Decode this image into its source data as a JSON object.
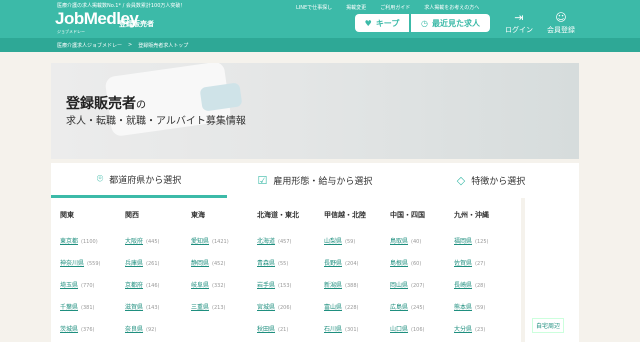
{
  "header": {
    "tagline": "医療介護の求人掲載数No.1* / 会員数累計100万人突破！",
    "logo": "JobMedley",
    "logo_sub": "ジョブメドレー",
    "job_type": "登録販売者",
    "links": [
      "LINEで仕事探し",
      "掲載変更",
      "ご利用ガイド",
      "求人掲載をお考えの方へ"
    ],
    "keep_label": "キープ",
    "recent_label": "最近見た求人",
    "login_label": "ログイン",
    "register_label": "会員登録"
  },
  "breadcrumb": [
    "医療介護求人ジョブメドレー",
    ">",
    "登録販売者求人トップ"
  ],
  "hero": {
    "title": "登録販売者",
    "title_suffix": "の",
    "subtitle": "求人・転職・就職・アルバイト募集情報"
  },
  "tabs": [
    {
      "label": "都道府県から選択",
      "icon": "map-pin-icon"
    },
    {
      "label": "雇用形態・給与から選択",
      "icon": "checkbox-icon"
    },
    {
      "label": "特徴から選択",
      "icon": "tag-icon"
    }
  ],
  "regions": [
    {
      "name": "関東",
      "prefs": [
        [
          "東京都",
          "(1100)"
        ],
        [
          "神奈川県",
          "(559)"
        ],
        [
          "埼玉県",
          "(770)"
        ],
        [
          "千葉県",
          "(381)"
        ],
        [
          "茨城県",
          "(376)"
        ]
      ]
    },
    {
      "name": "関西",
      "prefs": [
        [
          "大阪府",
          "(445)"
        ],
        [
          "兵庫県",
          "(261)"
        ],
        [
          "京都府",
          "(146)"
        ],
        [
          "滋賀県",
          "(143)"
        ],
        [
          "奈良県",
          "(92)"
        ]
      ]
    },
    {
      "name": "東海",
      "prefs": [
        [
          "愛知県",
          "(1421)"
        ],
        [
          "静岡県",
          "(452)"
        ],
        [
          "岐阜県",
          "(332)"
        ],
        [
          "三重県",
          "(213)"
        ]
      ]
    },
    {
      "name": "北海道・東北",
      "prefs": [
        [
          "北海道",
          "(457)"
        ],
        [
          "青森県",
          "(55)"
        ],
        [
          "岩手県",
          "(153)"
        ],
        [
          "宮城県",
          "(206)"
        ],
        [
          "秋田県",
          "(21)"
        ]
      ]
    },
    {
      "name": "甲信越・北陸",
      "prefs": [
        [
          "山梨県",
          "(59)"
        ],
        [
          "長野県",
          "(204)"
        ],
        [
          "新潟県",
          "(388)"
        ],
        [
          "富山県",
          "(228)"
        ],
        [
          "石川県",
          "(301)"
        ]
      ]
    },
    {
      "name": "中国・四国",
      "prefs": [
        [
          "鳥取県",
          "(40)"
        ],
        [
          "島根県",
          "(60)"
        ],
        [
          "岡山県",
          "(207)"
        ],
        [
          "広島県",
          "(245)"
        ],
        [
          "山口県",
          "(106)"
        ]
      ]
    },
    {
      "name": "九州・沖縄",
      "prefs": [
        [
          "福岡県",
          "(125)"
        ],
        [
          "佐賀県",
          "(27)"
        ],
        [
          "長崎県",
          "(28)"
        ],
        [
          "熊本県",
          "(59)"
        ],
        [
          "大分県",
          "(23)"
        ]
      ]
    }
  ],
  "side_button": "自宅周辺",
  "colors": {
    "brand": "#3cbaa8",
    "brand_dark": "#2ea896",
    "link": "#1f8f7f"
  }
}
